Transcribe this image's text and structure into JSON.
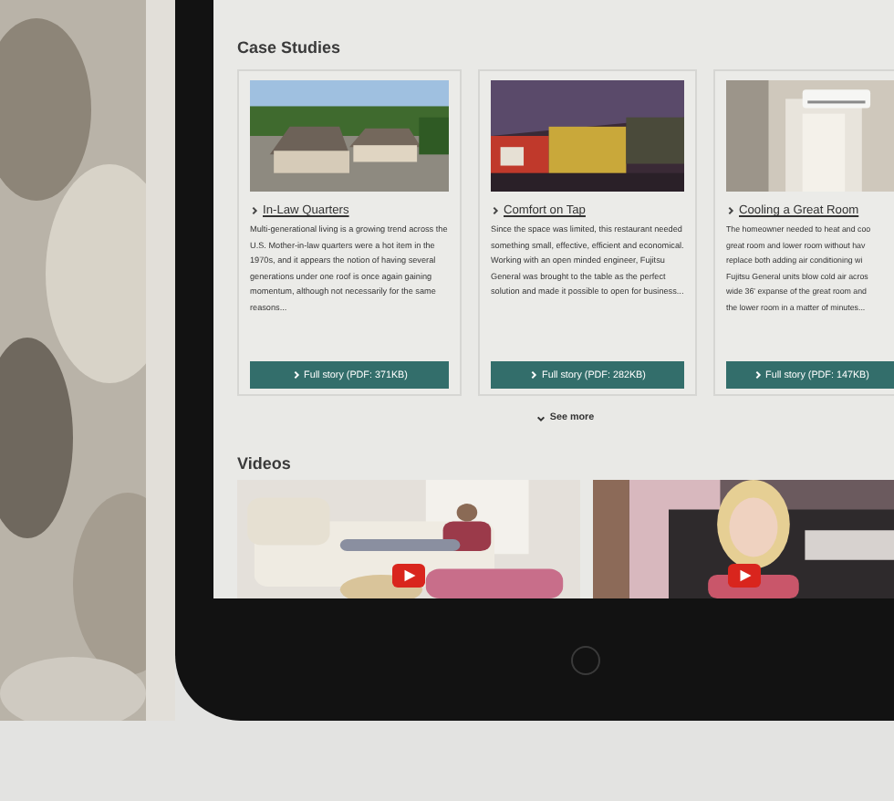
{
  "case_studies": {
    "heading": "Case Studies",
    "cards": [
      {
        "title": "In-Law Quarters",
        "summary": "Multi-generational living is a growing trend across the U.S. Mother-in-law quarters were a hot item in the 1970s, and it appears the notion of having several generations under one roof is once again gaining momentum, although not necessarily for the same reasons...",
        "button": "Full story (PDF: 371KB)"
      },
      {
        "title": "Comfort on Tap",
        "summary": "Since the space was limited, this restaurant needed something small, effective, efficient and economical. Working with an open minded engineer, Fujitsu General was brought to the table as the perfect solution and made it possible to open for business...",
        "button": "Full story (PDF: 282KB)"
      },
      {
        "title": "Cooling a Great Room",
        "summary": "The homeowner needed to heat and coo\ngreat room and lower room without hav\nreplace both adding air conditioning wi\nFujitsu General units blow cold air acros\nwide 36' expanse of the great room and\nthe lower room in a matter of minutes...",
        "button": "Full story (PDF: 147KB)"
      }
    ],
    "see_more": "See more"
  },
  "videos": {
    "heading": "Videos",
    "items": [
      {
        "kind": "video"
      },
      {
        "kind": "video"
      }
    ]
  }
}
